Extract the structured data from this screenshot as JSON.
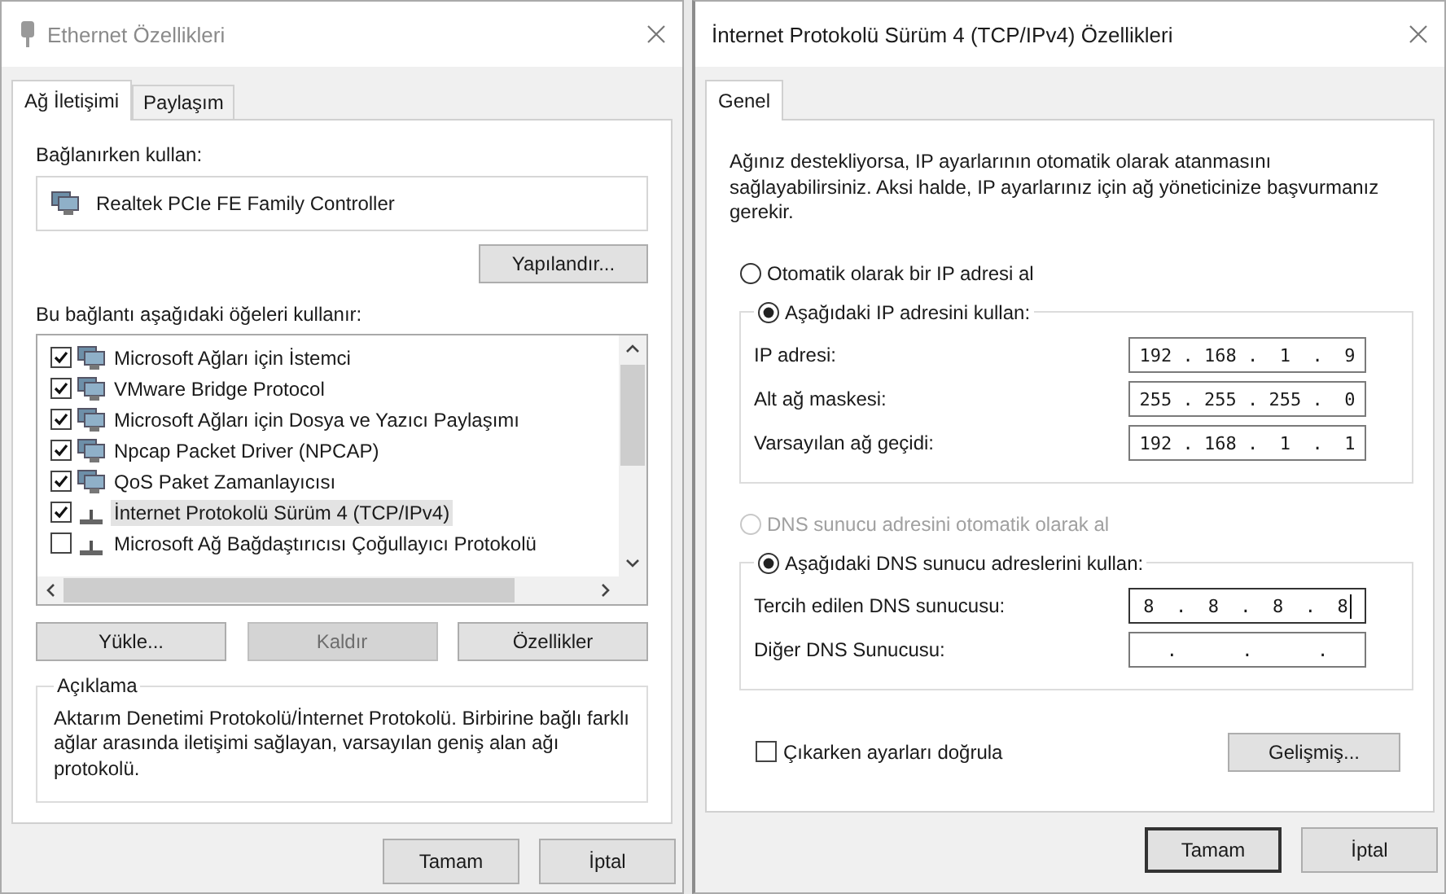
{
  "ethernet_window": {
    "title": "Ethernet Özellikleri",
    "active": false,
    "tabs": [
      {
        "label": "Ağ İletişimi",
        "selected": true
      },
      {
        "label": "Paylaşım",
        "selected": false
      }
    ],
    "connect_using_label": "Bağlanırken kullan:",
    "adapter": "Realtek PCIe FE Family Controller",
    "configure_button": "Yapılandır...",
    "items_label": "Bu bağlantı aşağıdaki öğeleri kullanır:",
    "items": [
      {
        "label": "Microsoft Ağları için İstemci",
        "checked": true,
        "selected": false,
        "kind": "client"
      },
      {
        "label": "VMware Bridge Protocol",
        "checked": true,
        "selected": false,
        "kind": "service"
      },
      {
        "label": "Microsoft Ağları için Dosya ve Yazıcı Paylaşımı",
        "checked": true,
        "selected": false,
        "kind": "service"
      },
      {
        "label": "Npcap Packet Driver (NPCAP)",
        "checked": true,
        "selected": false,
        "kind": "service"
      },
      {
        "label": "QoS Paket Zamanlayıcısı",
        "checked": true,
        "selected": false,
        "kind": "service"
      },
      {
        "label": "İnternet Protokolü Sürüm 4 (TCP/IPv4)",
        "checked": true,
        "selected": true,
        "kind": "protocol"
      },
      {
        "label": "Microsoft Ağ Bağdaştırıcısı Çoğullayıcı Protokolü",
        "checked": false,
        "selected": false,
        "kind": "protocol"
      }
    ],
    "item_buttons": [
      {
        "label": "Yükle...",
        "disabled": false
      },
      {
        "label": "Kaldır",
        "disabled": true
      },
      {
        "label": "Özellikler",
        "disabled": false
      }
    ],
    "description": {
      "legend": "Açıklama",
      "text": "Aktarım Denetimi Protokolü/İnternet Protokolü. Birbirine bağlı farklı ağlar arasında iletişimi sağlayan, varsayılan geniş alan ağı protokolü."
    },
    "footer_buttons": [
      {
        "label": "Tamam",
        "default": false
      },
      {
        "label": "İptal",
        "default": false
      }
    ]
  },
  "ipv4_window": {
    "title": "İnternet Protokolü Sürüm 4 (TCP/IPv4) Özellikleri",
    "active": true,
    "tabs": [
      {
        "label": "Genel",
        "selected": true
      }
    ],
    "intro": "Ağınız destekliyorsa, IP ayarlarının otomatik olarak atanmasını sağlayabilirsiniz. Aksi halde, IP ayarlarınız için ağ yöneticinize başvurmanız gerekir.",
    "ip_options": [
      {
        "label": "Otomatik olarak bir IP adresi al",
        "selected": false,
        "disabled": false
      },
      {
        "label": "Aşağıdaki IP adresini kullan:",
        "selected": true,
        "disabled": false
      }
    ],
    "ip_fields": [
      {
        "label": "IP adresi:",
        "value": "192 . 168 .  1  .  9",
        "focused": false
      },
      {
        "label": "Alt ağ maskesi:",
        "value": "255 . 255 . 255 .  0",
        "focused": false
      },
      {
        "label": "Varsayılan ağ geçidi:",
        "value": "192 . 168 .  1  .  1",
        "focused": false
      }
    ],
    "dns_options": [
      {
        "label": "DNS sunucu adresini otomatik olarak al",
        "selected": false,
        "disabled": true
      },
      {
        "label": "Aşağıdaki DNS sunucu adreslerini kullan:",
        "selected": true,
        "disabled": false
      }
    ],
    "dns_fields": [
      {
        "label": "Tercih edilen DNS sunucusu:",
        "value": "8  .  8  .  8  .  8",
        "focused": true
      },
      {
        "label": "Diğer DNS Sunucusu:",
        "value": ".      .      .",
        "focused": false
      }
    ],
    "validate": {
      "label": "Çıkarken ayarları doğrula",
      "checked": false
    },
    "advanced_button": "Gelişmiş...",
    "footer_buttons": [
      {
        "label": "Tamam",
        "default": true
      },
      {
        "label": "İptal",
        "default": false
      }
    ]
  }
}
